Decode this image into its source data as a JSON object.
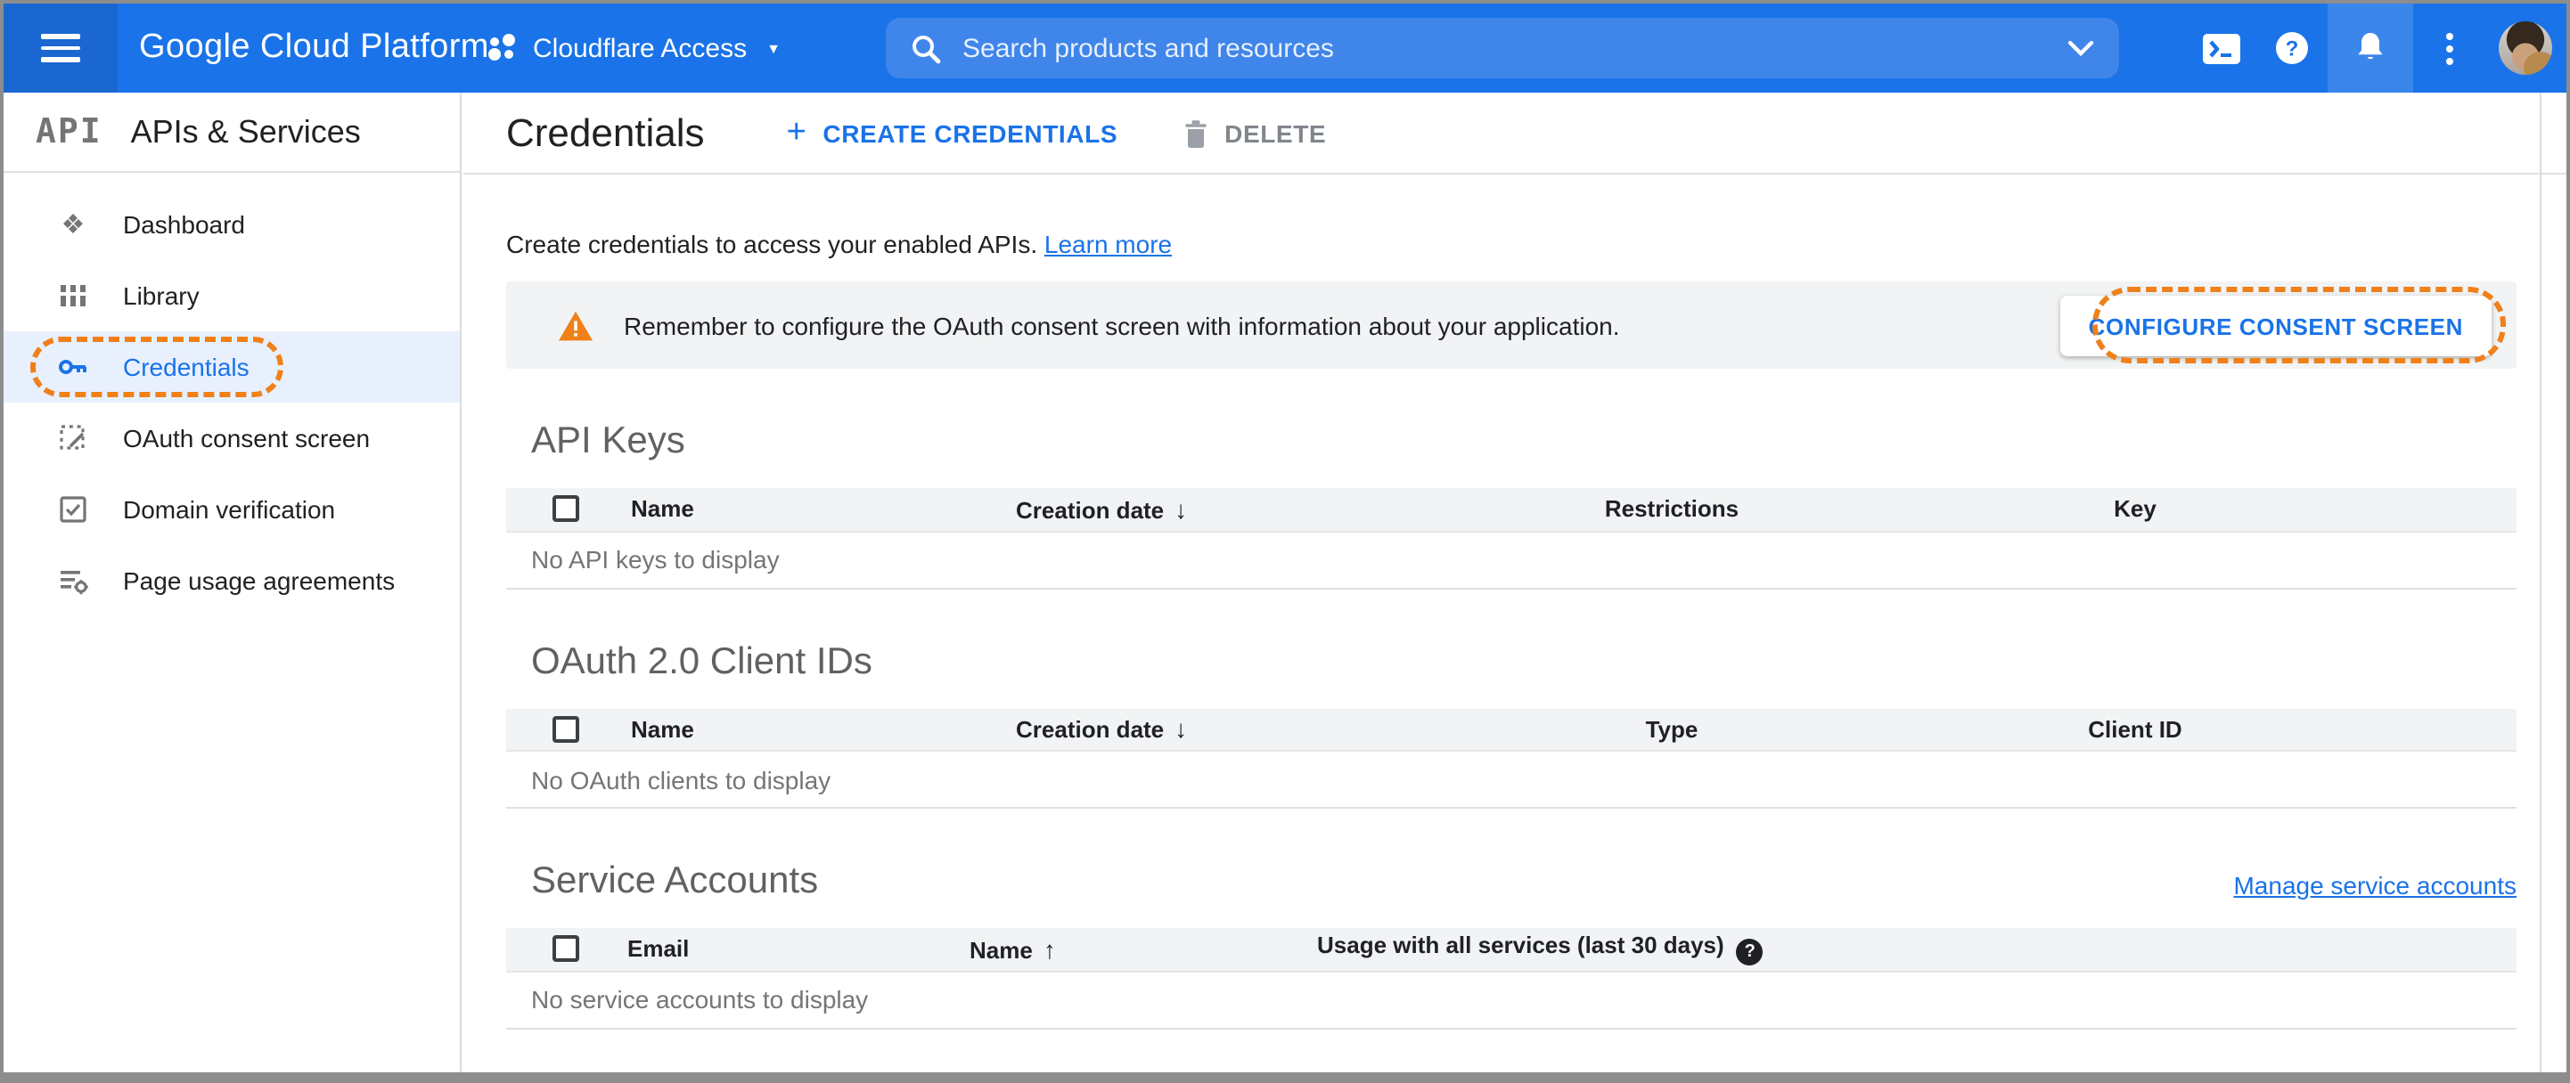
{
  "colors": {
    "appbar_blue": "#1a73e8",
    "appbar_menu_blue": "#1a67d2",
    "search_field_blue": "#3f85ea",
    "selected_nav_bg": "#e8f0fe",
    "annotation_orange": "#f0801a",
    "warning_orange": "#f08018",
    "link_blue": "#1a73e8",
    "table_header_bg": "#f1f3f4",
    "muted_text": "#757575"
  },
  "icons": {
    "menu": "hamburger",
    "project_grid": "dots-grid",
    "search": "magnifier",
    "search_chevron": "chevron-down",
    "cloud_shell": "terminal-prompt",
    "help": "question-circle",
    "notifications": "bell",
    "more": "vertical-dots",
    "dashboard": "❖",
    "sort_desc": "↓",
    "sort_asc": "↑",
    "project_caret": "▼",
    "plus": "+",
    "help_filled": "?",
    "warning_exclamation": "!"
  },
  "header": {
    "product_name": "Google Cloud Platform",
    "project_name": "Cloudflare Access",
    "search_placeholder": "Search products and resources"
  },
  "sidebar": {
    "logo_text": "API",
    "product": "APIs & Services",
    "items": [
      {
        "label": "Dashboard"
      },
      {
        "label": "Library"
      },
      {
        "label": "Credentials",
        "active": true
      },
      {
        "label": "OAuth consent screen"
      },
      {
        "label": "Domain verification"
      },
      {
        "label": "Page usage agreements"
      }
    ]
  },
  "toolbar": {
    "title": "Credentials",
    "create_label": "CREATE CREDENTIALS",
    "delete_label": "DELETE"
  },
  "intro": {
    "text": "Create credentials to access your enabled APIs.",
    "link": "Learn more"
  },
  "banner": {
    "message": "Remember to configure the OAuth consent screen with information about your application.",
    "button": "CONFIGURE CONSENT SCREEN"
  },
  "sections": {
    "api_keys": {
      "title": "API Keys",
      "headers": [
        {
          "label": "Name"
        },
        {
          "label": "Creation date",
          "sort": "desc"
        },
        {
          "label": "Restrictions"
        },
        {
          "label": "Key"
        }
      ],
      "empty": "No API keys to display"
    },
    "oauth_clients": {
      "title": "OAuth 2.0 Client IDs",
      "headers": [
        {
          "label": "Name"
        },
        {
          "label": "Creation date",
          "sort": "desc"
        },
        {
          "label": "Type"
        },
        {
          "label": "Client ID"
        }
      ],
      "empty": "No OAuth clients to display"
    },
    "service_accounts": {
      "title": "Service Accounts",
      "manage_link": "Manage service accounts",
      "headers": [
        {
          "label": "Email"
        },
        {
          "label": "Name",
          "sort": "asc"
        },
        {
          "label": "Usage with all services (last 30 days)"
        }
      ],
      "empty": "No service accounts to display"
    }
  }
}
